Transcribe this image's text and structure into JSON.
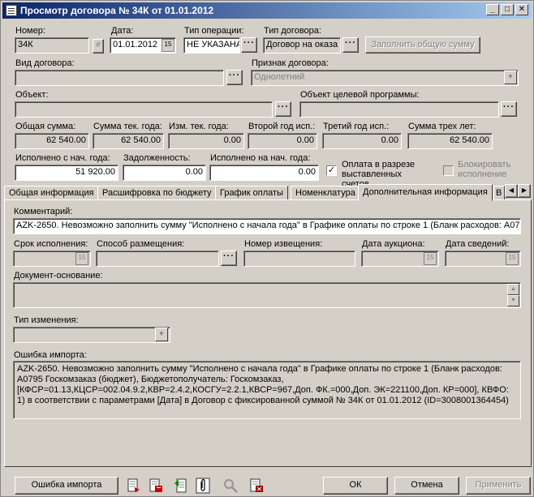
{
  "window": {
    "title": "Просмотр договора № 34К от 01.01.2012"
  },
  "header": {
    "number_label": "Номер:",
    "number_value": "34К",
    "date_label": "Дата:",
    "date_value": "01.01.2012",
    "op_type_label": "Тип операции:",
    "op_type_value": "НЕ УКАЗАНА",
    "contract_type_label": "Тип договора:",
    "contract_type_value": "Договор на оказа",
    "fill_sum_button": "Заполнить общую сумму",
    "kind_label": "Вид договора:",
    "kind_value": "",
    "sign_label": "Признак договора:",
    "sign_value": "Однолетний",
    "object_label": "Объект:",
    "object_value": "",
    "target_object_label": "Объект целевой программы:",
    "target_object_value": ""
  },
  "sums": {
    "total_label": "Общая сумма:",
    "total_value": "62 540.00",
    "cur_year_label": "Сумма тек. года:",
    "cur_year_value": "62 540.00",
    "change_label": "Изм. тек. года:",
    "change_value": "0.00",
    "second_year_label": "Второй год исп.:",
    "second_year_value": "0.00",
    "third_year_label": "Третий год исп.:",
    "third_year_value": "0.00",
    "three_years_label": "Сумма трех лет:",
    "three_years_value": "62 540.00",
    "executed_label": "Исполнено с нач. года:",
    "executed_value": "51 920.00",
    "debt_label": "Задолженность:",
    "debt_value": "0.00",
    "executed_start_label": "Исполнено на нач. года:",
    "executed_start_value": "0.00",
    "pay_checkbox_label": "Оплата в разрезе выставленных счетов",
    "block_checkbox_label": "Блокировать исполнение"
  },
  "tabs": [
    "Общая информация",
    "Расшифровка по бюджету",
    "График оплаты",
    "Номенклатура",
    "Дополнительная информация",
    "В"
  ],
  "panel": {
    "comment_label": "Комментарий:",
    "comment_value": "AZK-2650. Невозможно заполнить сумму \"Исполнено с начала года\" в Графике оплаты по строке 1 (Бланк расходов: А07",
    "term_label": "Срок исполнения:",
    "placement_label": "Способ размещения:",
    "notice_label": "Номер извещения:",
    "auction_label": "Дата аукциона:",
    "info_date_label": "Дата сведений:",
    "basis_label": "Документ-основание:",
    "change_type_label": "Тип изменения:",
    "import_error_label": "Ошибка импорта:",
    "import_error_text": "AZK-2650. Невозможно заполнить сумму \"Исполнено с начала года\" в Графике оплаты по строке 1 (Бланк расходов: А0795 Госкомзаказ (бюджет), Бюджетополучатель: Госкомзаказ, [КФСР=01.13,КЦСР=002.04.9.2,КВР=2.4.2,КОСГУ=2.2.1,КВСР=967,Доп. ФК.=000,Доп. ЭК=221100,Доп. КР=000], КВФО: 1) в соответствии с параметрами [Дата] в Договор с фиксированной суммой № 34К от 01.01.2012 (ID=3008001364454)"
  },
  "footer": {
    "import_error_button": "Ошибка импорта",
    "ok_button": "ОК",
    "cancel_button": "Отмена",
    "apply_button": "Применить"
  },
  "colors": {
    "title_start": "#0a246a",
    "title_end": "#a6caf0",
    "face": "#d4d0c8"
  }
}
